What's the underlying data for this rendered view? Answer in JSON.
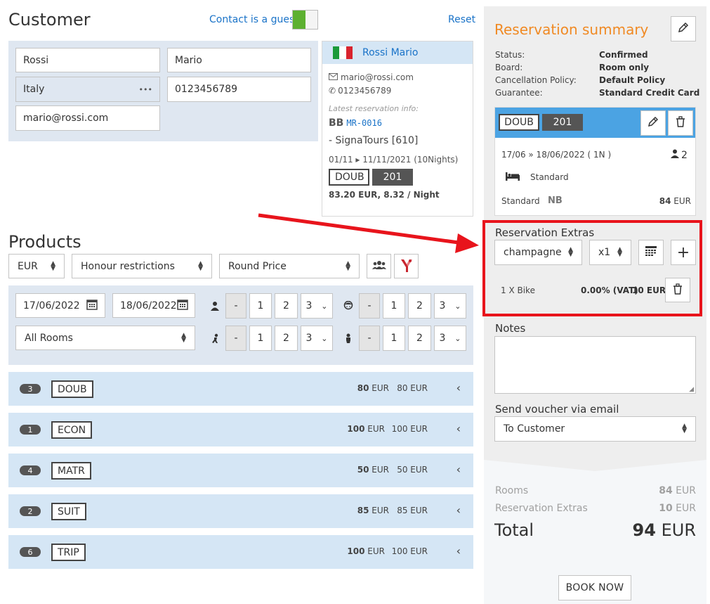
{
  "customer": {
    "title": "Customer",
    "guest_label": "Contact is a guest",
    "reset_label": "Reset",
    "last_name": "Rossi",
    "first_name": "Mario",
    "country": "Italy",
    "phone": "0123456789",
    "email": "mario@rossi.com",
    "more_icon": "•••"
  },
  "guest_card": {
    "name": "Rossi Mario",
    "email": "mario@rossi.com",
    "phone": "0123456789",
    "latest_label": "Latest reservation info:",
    "board": "BB",
    "code": "MR-0016",
    "agency": "- SignaTours [610]",
    "dates": "01/11 ▸ 11/11/2021 (10Nights)",
    "room_type": "DOUB",
    "room_no": "201",
    "price": "83.20 EUR, 8.32 / Night"
  },
  "products": {
    "title": "Products",
    "currency": "EUR",
    "restrictions": "Honour restrictions",
    "price_mode": "Round Price",
    "date_from": "17/06/2022",
    "date_to": "18/06/2022",
    "rooms_filter": "All Rooms",
    "count_buttons": [
      "-",
      "1",
      "2",
      "3"
    ],
    "rows": [
      {
        "count": "3",
        "code": "DOUB",
        "price1": "80",
        "price2": "80 EUR",
        "cur": "EUR"
      },
      {
        "count": "1",
        "code": "ECON",
        "price1": "100",
        "price2": "100 EUR",
        "cur": "EUR"
      },
      {
        "count": "4",
        "code": "MATR",
        "price1": "50",
        "price2": "50 EUR",
        "cur": "EUR"
      },
      {
        "count": "2",
        "code": "SUIT",
        "price1": "85",
        "price2": "85 EUR",
        "cur": "EUR"
      },
      {
        "count": "6",
        "code": "TRIP",
        "price1": "100",
        "price2": "100 EUR",
        "cur": "EUR"
      }
    ]
  },
  "summary": {
    "title": "Reservation summary",
    "status_label": "Status:",
    "status": "Confirmed",
    "board_label": "Board:",
    "board": "Room only",
    "cancel_label": "Cancellation Policy:",
    "cancel": "Default Policy",
    "guarantee_label": "Guarantee:",
    "guarantee": "Standard Credit Card",
    "room_type": "DOUB",
    "room_no": "201",
    "dates": "17/06 » 18/06/2022 ( 1N )",
    "guests": "2",
    "bed": "Standard",
    "rate": "Standard",
    "rate_code": "NB",
    "rate_price": "84",
    "rate_cur": "EUR"
  },
  "extras": {
    "title": "Reservation Extras",
    "item": "champagne",
    "qty": "x1",
    "line_name": "1 X Bike",
    "line_vat": "0.00% (VAT)",
    "line_price": "10 EUR"
  },
  "notes": {
    "label": "Notes"
  },
  "voucher": {
    "label": "Send voucher via email",
    "value": "To Customer"
  },
  "totals": {
    "rooms_label": "Rooms",
    "rooms_value": "84",
    "rooms_cur": "EUR",
    "extras_label": "Reservation Extras",
    "extras_value": "10",
    "extras_cur": "EUR",
    "total_label": "Total",
    "total_value": "94",
    "total_cur": "EUR",
    "book_label": "BOOK NOW"
  },
  "colors": {
    "accent": "#f08a24",
    "link": "#1a73c8",
    "highlight": "#e8141c",
    "room_header": "#4ba3e3"
  }
}
